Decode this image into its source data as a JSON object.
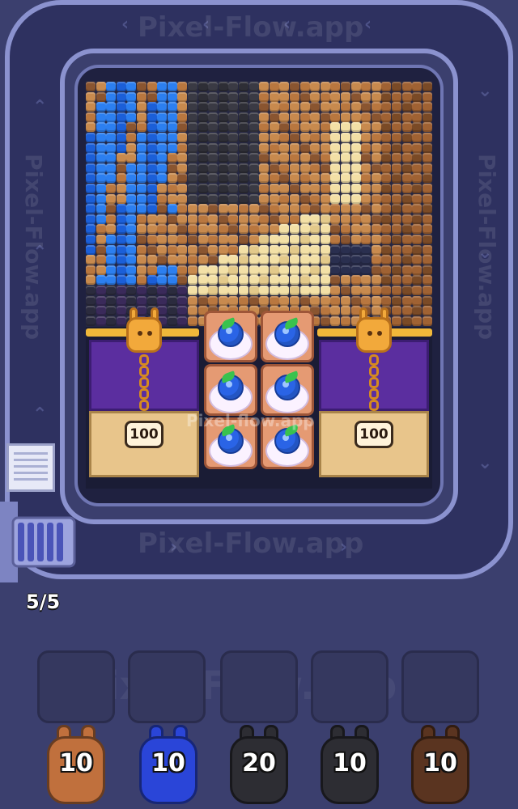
{
  "watermark": {
    "text": "Pixel-Flow.app",
    "board_text": "Pixel-flow.app"
  },
  "board": {
    "locks": [
      {
        "value": "100"
      },
      {
        "value": "100"
      }
    ],
    "berry_tiles": 6
  },
  "queue_counter": "5/5",
  "slots": [
    {},
    {},
    {},
    {},
    {}
  ],
  "shooters": [
    {
      "count": "10",
      "color": "#c0703d",
      "name": "brown"
    },
    {
      "count": "10",
      "color": "#2a45d8",
      "name": "blue"
    },
    {
      "count": "20",
      "color": "#2d2d33",
      "name": "black"
    },
    {
      "count": "10",
      "color": "#2d2d33",
      "name": "black"
    },
    {
      "count": "10",
      "color": "#5a3420",
      "name": "dark-brown"
    }
  ],
  "colors": {
    "background": "#3b3f6e",
    "track": "#8b92cf",
    "lock": "#f2a93b",
    "berry": "#2a64e6"
  }
}
